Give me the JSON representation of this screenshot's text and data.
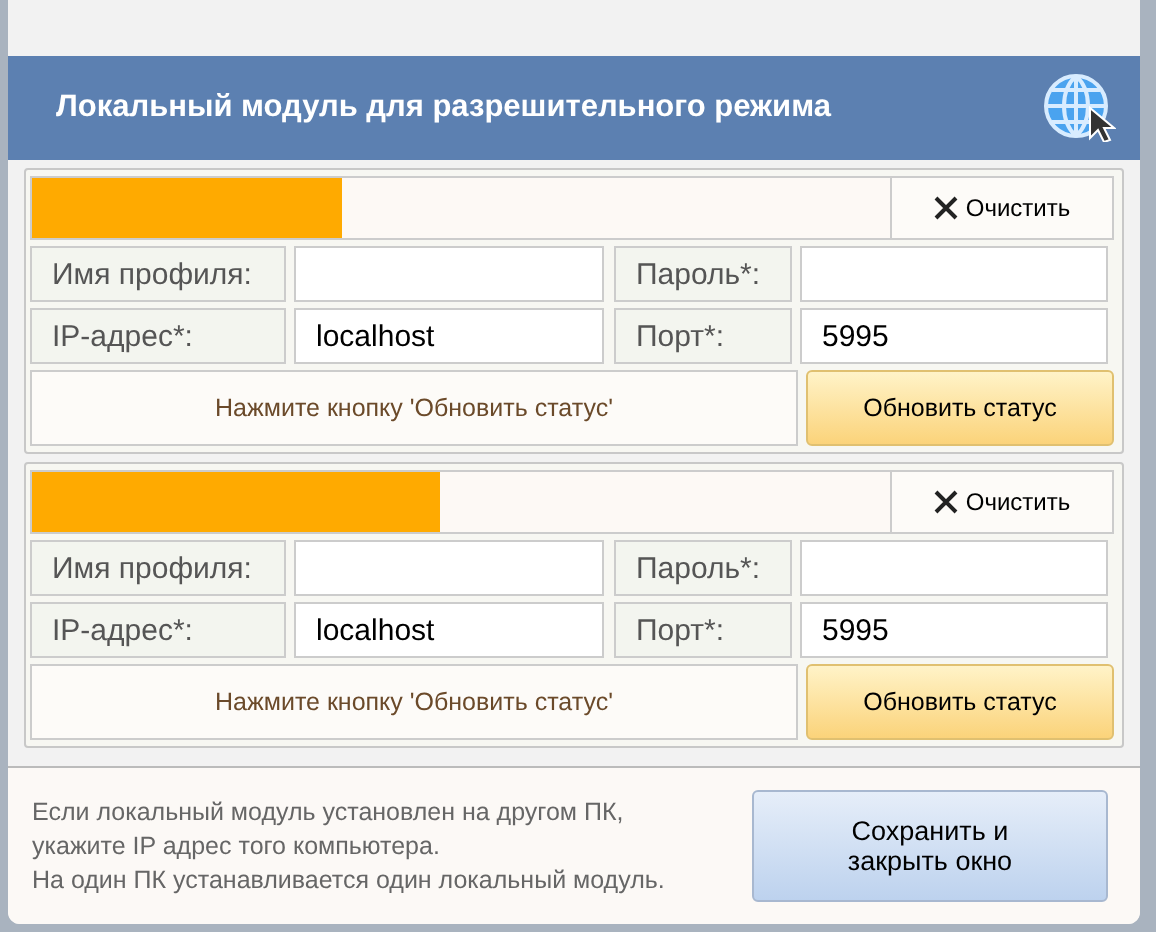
{
  "dialog": {
    "title": "Локальный модуль для разрешительного режима"
  },
  "modules": [
    {
      "clear_button": "Очистить",
      "fields": [
        {
          "label": "Имя профиля:"
        },
        {
          "label": "Пароль*:"
        },
        {
          "label": "IP-адрес*:",
          "value": "localhost"
        },
        {
          "label": "Порт*:",
          "value": "5995"
        }
      ],
      "status": "Нажмите кнопку 'Обновить статус'",
      "refresh_button": "Обновить статус"
    },
    {
      "clear_button": "Очистить",
      "fields": [
        {
          "label": "Имя профиля:"
        },
        {
          "label": "Пароль*:"
        },
        {
          "label": "IP-адрес*:",
          "value": "localhost"
        },
        {
          "label": "Порт*:",
          "value": "5995"
        }
      ],
      "status": "Нажмите кнопку 'Обновить статус'",
      "refresh_button": "Обновить статус"
    }
  ],
  "footer": {
    "note_lines": [
      "Если локальный модуль установлен на другом ПК,",
      "укажите IP адрес того компьютера.",
      "На один ПК устанавливается один локальный модуль."
    ],
    "save_button": "Сохранить и закрыть окно"
  }
}
